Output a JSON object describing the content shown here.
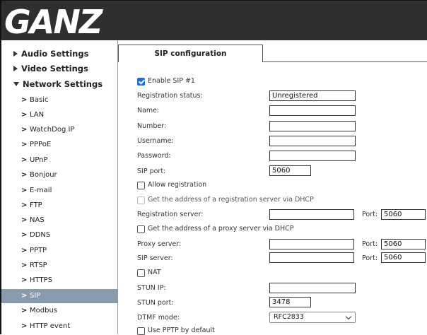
{
  "logo": {
    "text": "GANZ"
  },
  "colors": {
    "header_bg": "#2f2f2f",
    "logo": "#ffffff",
    "active_item_bg": "#8a9aad",
    "checkbox_checked": "#1f6fd1"
  },
  "sidebar": {
    "sections": [
      {
        "label": "Audio Settings",
        "expanded": false
      },
      {
        "label": "Video Settings",
        "expanded": false
      },
      {
        "label": "Network Settings",
        "expanded": true
      }
    ],
    "items": [
      "Basic",
      "LAN",
      "WatchDog IP",
      "PPPoE",
      "UPnP",
      "Bonjour",
      "E-mail",
      "FTP",
      "NAS",
      "DDNS",
      "PPTP",
      "RTSP",
      "HTTPS",
      "SIP",
      "Modbus",
      "HTTP event"
    ],
    "active_item": "SIP"
  },
  "tab": {
    "label": "SIP configuration"
  },
  "form": {
    "enable_sip": {
      "label": "Enable SIP #1",
      "checked": true
    },
    "registration_status": {
      "label": "Registration status:",
      "value": "Unregistered"
    },
    "name": {
      "label": "Name:",
      "value": ""
    },
    "number": {
      "label": "Number:",
      "value": ""
    },
    "username": {
      "label": "Username:",
      "value": ""
    },
    "password": {
      "label": "Password:",
      "value": ""
    },
    "sip_port": {
      "label": "SIP port:",
      "value": "5060"
    },
    "allow_registration": {
      "label": "Allow registration",
      "checked": false
    },
    "dhcp_registration": {
      "label": "Get the address of a registration server via DHCP",
      "checked": false,
      "disabled": true
    },
    "registration_server": {
      "label": "Registration server:",
      "value": "",
      "port_label": "Port:",
      "port": "5060"
    },
    "dhcp_proxy": {
      "label": "Get the address of a proxy server via DHCP",
      "checked": false
    },
    "proxy_server": {
      "label": "Proxy server:",
      "value": "",
      "port_label": "Port:",
      "port": "5060"
    },
    "sip_server": {
      "label": "SIP server:",
      "value": "",
      "port_label": "Port:",
      "port": "5060"
    },
    "nat": {
      "label": "NAT",
      "checked": false
    },
    "stun_ip": {
      "label": "STUN IP:",
      "value": ""
    },
    "stun_port": {
      "label": "STUN port:",
      "value": "3478"
    },
    "dtmf_mode": {
      "label": "DTMF mode:",
      "selected": "RFC2833"
    },
    "use_pptp": {
      "label": "Use PPTP by default",
      "checked": false
    }
  }
}
